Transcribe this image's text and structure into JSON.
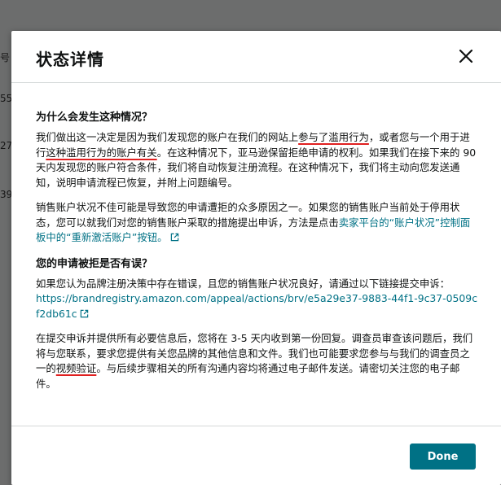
{
  "background": {
    "fragments": [
      "号",
      "55",
      "27",
      "39"
    ]
  },
  "modal": {
    "title": "状态详情",
    "close_icon": "close-icon",
    "section1": {
      "title": "为什么会发生这种情况？",
      "p1": {
        "t1": "我们做出这一决定是因为我们发现您的账户在我们的网站上",
        "t2": "参与了滥用行为",
        "t3": "，或者您与一个用于进行",
        "t4": "这种滥用行为的账户有关",
        "t5": "。在这种情况下，亚马逊保留拒绝申请的权利。如果我们在接下来的 90 天内发现您的账户符合条件，我们将自动恢复注册流程。在这种情况下，我们将主动向您发送通知，说明申请流程已恢复，并附上问题编号。"
      },
      "p2": {
        "t1": "销售账户状况不佳可能是导致您的申请遭拒的众多原因之一。如果您的销售账户当前处于停用状态，您可以就我们对您的销售账户采取的措施提出申诉，方法是点击",
        "link": "卖家平台的“账户状况”控制面板中的“重新激活账户”按钮。",
        "ext_icon": "external-link-icon"
      }
    },
    "section2": {
      "title": "您的申请被拒是否有误？",
      "p1": {
        "text": "如果您认为品牌注册决策中存在错误，且您的销售账户状况良好，请通过以下链接提交申诉：",
        "url": "https://brandregistry.amazon.com/appeal/actions/brv/e5a29e37-9883-44f1-9c37-0509cf2db61c",
        "ext_icon": "external-link-icon"
      },
      "p2": {
        "t1": "在提交申诉并提供所有必要信息后，您将在 3-5 天内收到第一份回复。调查员审查该问题后，我们将与您联系，要求您提供有关您品牌的其他信息和文件。我们也可能要求您参与与我们的调查员之一的",
        "t2": "视频验证",
        "t3": "。与后续步骤相关的所有沟通内容均将通过电子邮件发送。请密切关注您的电子邮件。"
      }
    },
    "done_label": "Done"
  },
  "colors": {
    "accent": "#007185",
    "annotation": "#e02020",
    "overlay": "rgba(0,0,0,0.55)"
  }
}
